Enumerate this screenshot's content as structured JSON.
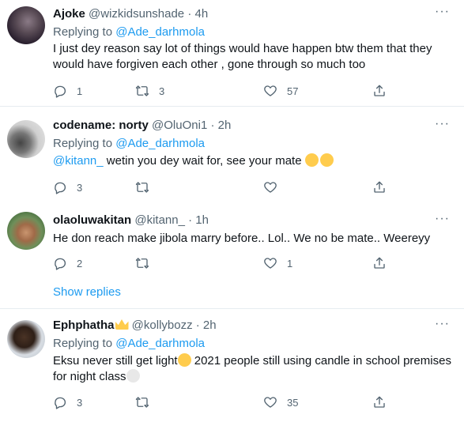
{
  "tweets": [
    {
      "name": "Ajoke",
      "handle": "@wizkidsunshade · 4h",
      "replying_prefix": "Replying to ",
      "replying_to": "@Ade_darhmola",
      "body": "I just dey reason say lot of things would have happen btw them that they would have forgiven each other , gone through so much too",
      "reply_count": "1",
      "retweet_count": "3",
      "like_count": "57"
    },
    {
      "name": "codename: norty",
      "handle": "@OluOni1 · 2h",
      "replying_prefix": "Replying to ",
      "replying_to": "@Ade_darhmola",
      "mention": "@kitann_",
      "body": " wetin you dey wait for, see your mate ",
      "reply_count": "3",
      "retweet_count": "",
      "like_count": ""
    },
    {
      "name": "olaoluwakitan",
      "handle": "@kitann_ · 1h",
      "body": "He don reach make jibola marry before.. Lol.. We no be mate.. Weereyy",
      "reply_count": "2",
      "retweet_count": "",
      "like_count": "1",
      "show_replies": "Show replies"
    },
    {
      "name": "Ephphatha",
      "handle": "@kollybozz · 2h",
      "replying_prefix": "Replying to ",
      "replying_to": "@Ade_darhmola",
      "body_part1": "Eksu never still get light",
      "body_part2": " 2021 people still using candle in school premises for night class",
      "reply_count": "3",
      "retweet_count": "",
      "like_count": "35"
    }
  ],
  "icons": {
    "reply": "reply-icon",
    "retweet": "retweet-icon",
    "like": "heart-icon",
    "share": "share-icon",
    "more": "more-icon"
  },
  "colors": {
    "accent": "#1d9bf0",
    "secondary_text": "#536471",
    "primary_text": "#0f1419",
    "separator": "#e6ecf0"
  }
}
